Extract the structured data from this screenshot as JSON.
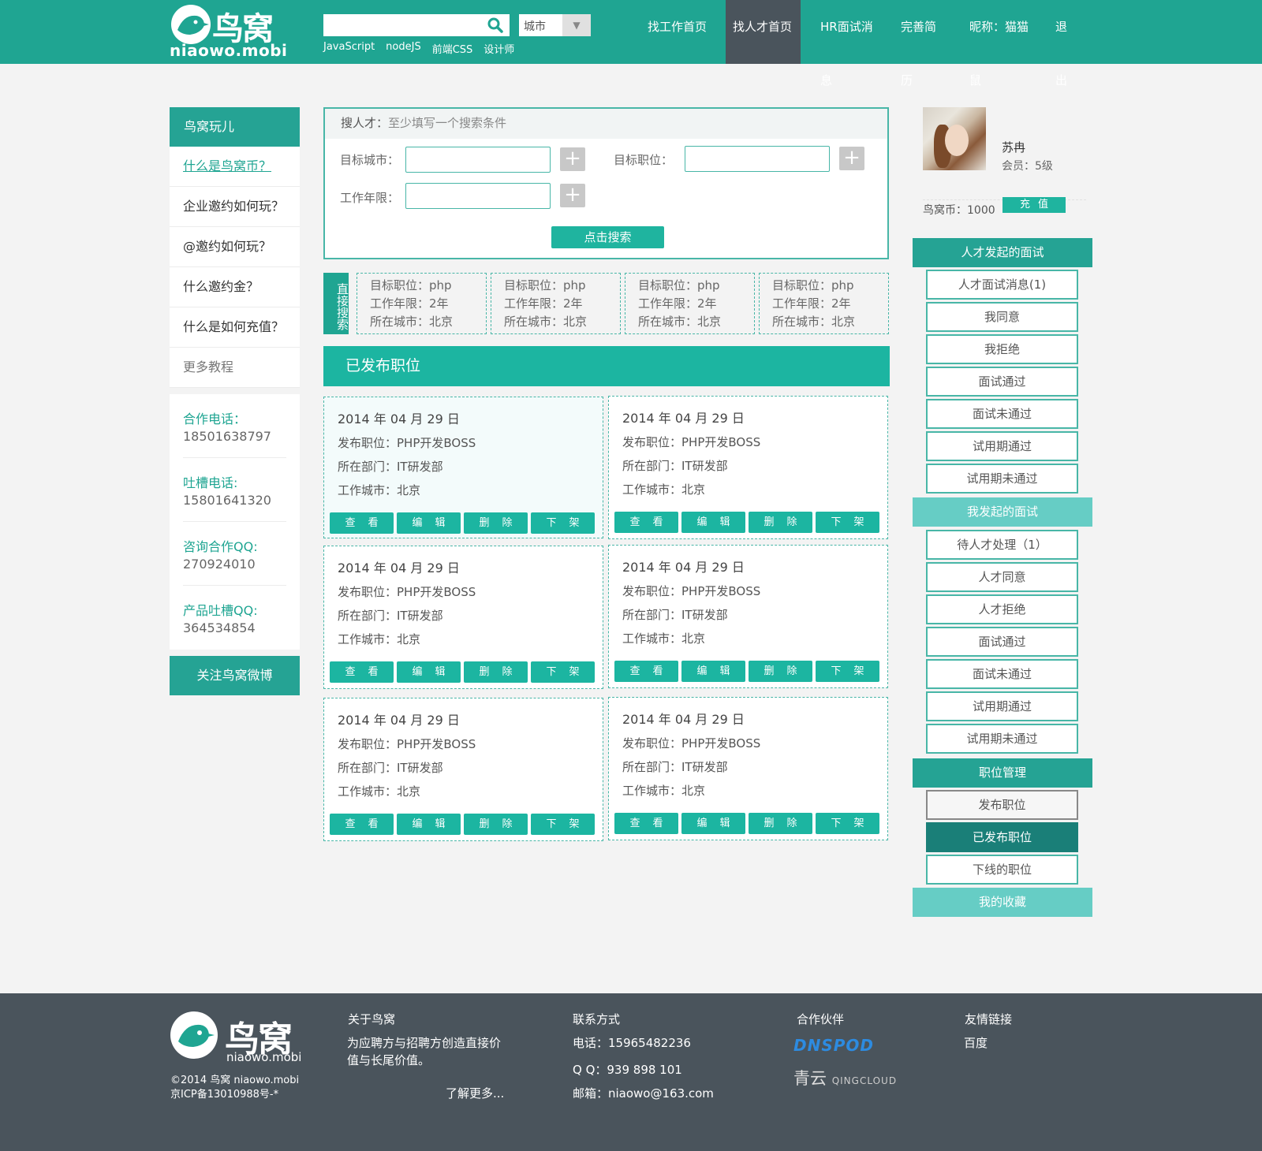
{
  "header": {
    "logo_cn": "鸟窝",
    "logo_en": "niaowo.mobi",
    "search_placeholder": "",
    "city_select": "城市",
    "hot_tags": [
      "JavaScript",
      "nodeJS",
      "前端CSS",
      "设计师"
    ],
    "nav": [
      "找工作首页",
      "找人才首页",
      "HR面试消息",
      "完善简历",
      "昵称：猫猫鼠",
      "退出"
    ],
    "nav_active": "找人才首页"
  },
  "left_panel": {
    "header": "鸟窝玩儿",
    "items": [
      "什么是鸟窝币？",
      "企业邀约如何玩？",
      "@邀约如何玩？",
      "什么邀约金？",
      "什么是如何充值？",
      "更多教程"
    ],
    "contacts": [
      {
        "label": "合作电话：",
        "value": "18501638797"
      },
      {
        "label": "吐槽电话:",
        "value": "15801641320"
      },
      {
        "label": "咨询合作QQ:",
        "value": "270924010"
      },
      {
        "label": "产品吐槽QQ:",
        "value": "364534854"
      }
    ],
    "weibo_button": "关注鸟窝微博"
  },
  "search_panel": {
    "title": "搜人才：",
    "hint": "至少填写一个搜索条件",
    "city_label": "目标城市：",
    "position_label": "目标职位：",
    "years_label": "工作年限：",
    "plus": "+",
    "submit": "点击搜索"
  },
  "direct_search": {
    "label": "直接搜索",
    "cards": [
      {
        "position": "目标职位：php",
        "years": "工作年限：2年",
        "city": "所在城市：北京"
      },
      {
        "position": "目标职位：php",
        "years": "工作年限：2年",
        "city": "所在城市：北京"
      },
      {
        "position": "目标职位：php",
        "years": "工作年限：2年",
        "city": "所在城市：北京"
      },
      {
        "position": "目标职位：php",
        "years": "工作年限：2年",
        "city": "所在城市：北京"
      }
    ]
  },
  "published": {
    "header": "已发布职位",
    "buttons": [
      "查看",
      "编辑",
      "删除",
      "下架"
    ],
    "jobs": [
      {
        "date": "2014 年 04 月 29 日",
        "position": "发布职位：PHP开发BOSS",
        "dept": "所在部门：IT研发部",
        "city": "工作城市：北京"
      },
      {
        "date": "2014 年 04 月 29 日",
        "position": "发布职位：PHP开发BOSS",
        "dept": "所在部门：IT研发部",
        "city": "工作城市：北京"
      },
      {
        "date": "2014 年 04 月 29 日",
        "position": "发布职位：PHP开发BOSS",
        "dept": "所在部门：IT研发部",
        "city": "工作城市：北京"
      },
      {
        "date": "2014 年 04 月 29 日",
        "position": "发布职位：PHP开发BOSS",
        "dept": "所在部门：IT研发部",
        "city": "工作城市：北京"
      },
      {
        "date": "2014 年 04 月 29 日",
        "position": "发布职位：PHP开发BOSS",
        "dept": "所在部门：IT研发部",
        "city": "工作城市：北京"
      },
      {
        "date": "2014 年 04 月 29 日",
        "position": "发布职位：PHP开发BOSS",
        "dept": "所在部门：IT研发部",
        "city": "工作城市：北京"
      }
    ]
  },
  "user": {
    "name": "苏冉",
    "level": "会员：5级",
    "coins": "鸟窝币：1000",
    "recharge": "充值"
  },
  "right_panel": {
    "talent_header": "人才发起的面试",
    "talent_items": [
      "人才面试消息(1)",
      "我同意",
      "我拒绝",
      "面试通过",
      "面试未通过",
      "试用期通过",
      "试用期未通过"
    ],
    "mine_header": "我发起的面试",
    "mine_items": [
      "待人才处理（1）",
      "人才同意",
      "人才拒绝",
      "面试通过",
      "面试未通过",
      "试用期通过",
      "试用期未通过"
    ],
    "jobs_header": "职位管理",
    "jobs_items": [
      "发布职位",
      "已发布职位",
      "下线的职位"
    ],
    "fav_header": "我的收藏"
  },
  "footer": {
    "logo_cn": "鸟窝",
    "logo_en": "niaowo.mobi",
    "copyright": "©2014 鸟窝 niaowo.mobi",
    "icp": "京ICP备13010988号-*",
    "about_title": "关于鸟窝",
    "about_text": "为应聘方与招聘方创造直接价值与长尾价值。",
    "about_more": "了解更多...",
    "contact_title": "联系方式",
    "phone": "电话：15965482236",
    "qq": "Q Q：939 898 101",
    "email": "邮箱：niaowo@163.com",
    "partners_title": "合作伙伴",
    "partner_dnspod": "DNSPOD",
    "partner_qingcloud_cn": "青云",
    "partner_qingcloud_en": "QINGCLOUD",
    "links_title": "友情链接",
    "link_baidu": "百度"
  }
}
